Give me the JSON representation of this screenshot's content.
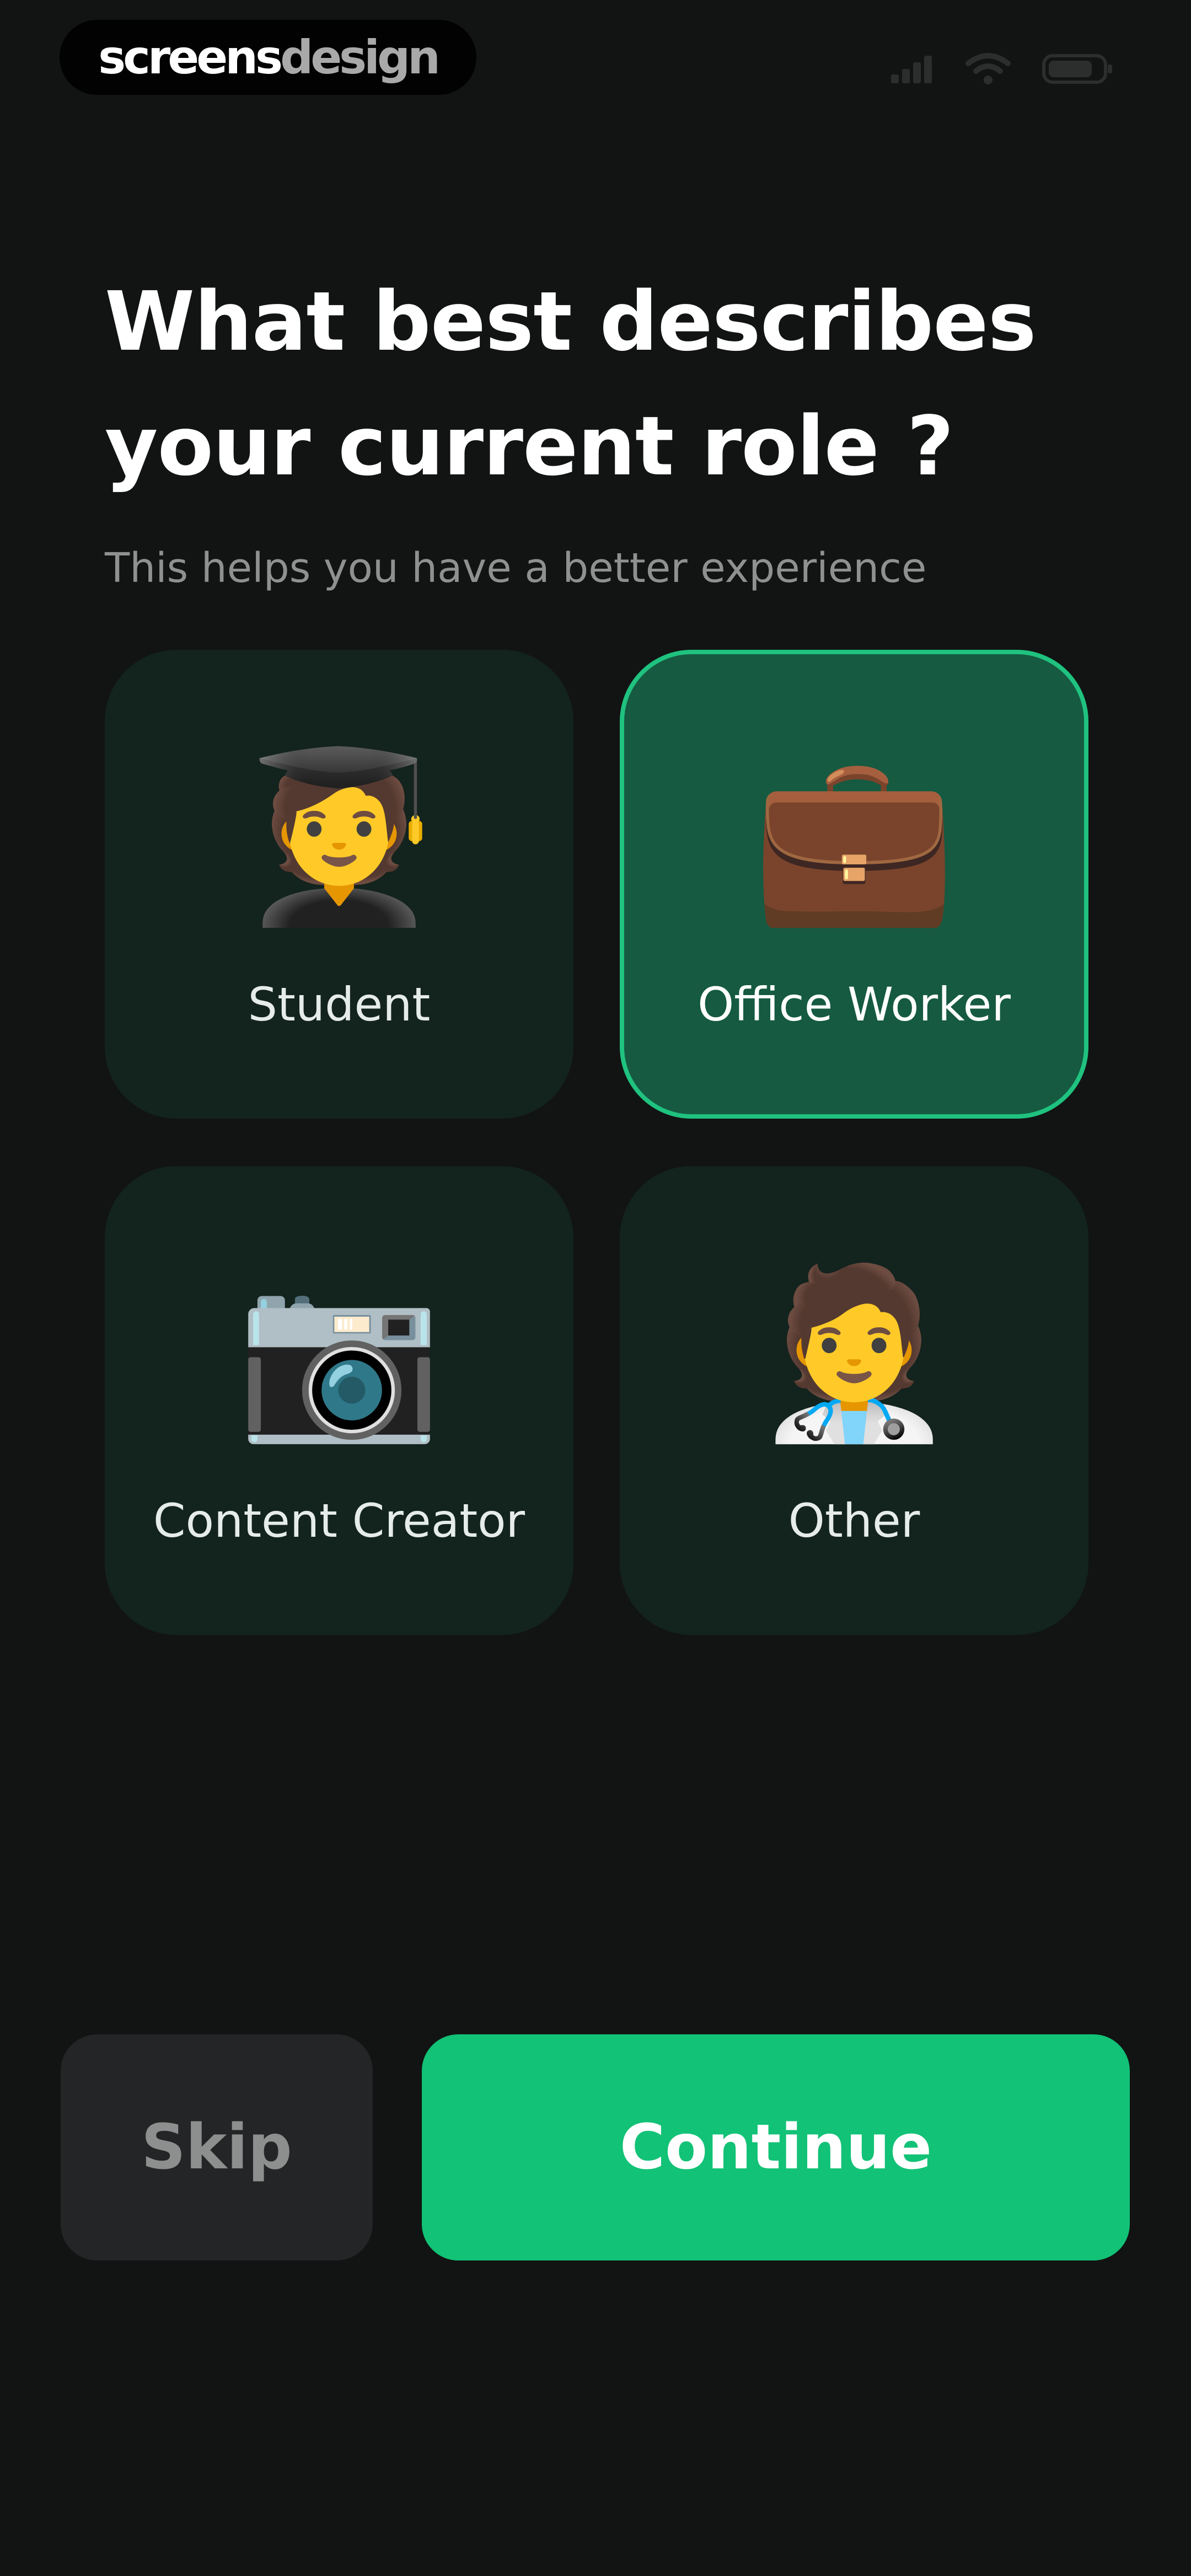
{
  "status_bar": {
    "brand_primary": "screens",
    "brand_secondary": "design",
    "icons": [
      "cellular-signal-icon",
      "wifi-icon",
      "battery-icon"
    ]
  },
  "header": {
    "title_line1": "What best describes",
    "title_line2": "your current role ?",
    "subtitle": "This helps you have a better experience"
  },
  "options": [
    {
      "label": "Student",
      "emoji": "🧑‍🎓",
      "selected": false
    },
    {
      "label": "Office Worker",
      "emoji": "💼",
      "selected": true
    },
    {
      "label": "Content Creator",
      "emoji": "📷",
      "selected": false
    },
    {
      "label": "Other",
      "emoji": "🧑‍⚕️",
      "selected": false
    }
  ],
  "actions": {
    "skip_label": "Skip",
    "continue_label": "Continue"
  },
  "colors": {
    "background": "#111413",
    "card": "#13231d",
    "card_selected": "#155a41",
    "accent": "#12c276",
    "skip_button": "#242526"
  }
}
